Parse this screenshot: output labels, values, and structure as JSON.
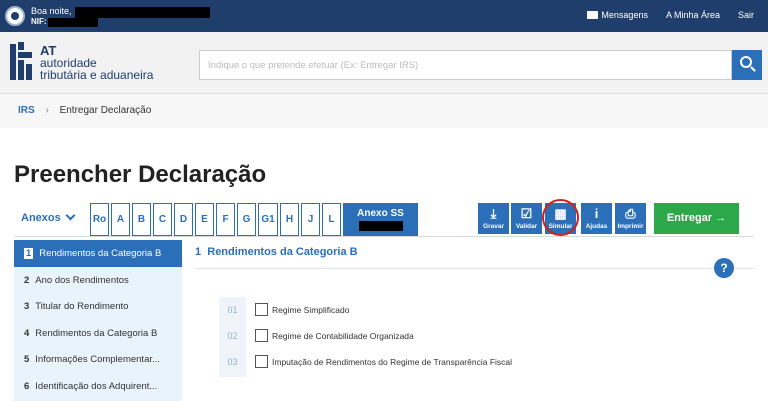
{
  "topbar": {
    "greeting": "Boa noite,",
    "nif_label": "NIF:",
    "links": [
      "Mensagens",
      "A Minha Área",
      "Sair"
    ]
  },
  "logo": {
    "line1": "AT",
    "line2": "autoridade",
    "line3": "tributária e aduaneira"
  },
  "search": {
    "placeholder": "Indique o que pretende efetuar (Ex: Entregar IRS)"
  },
  "breadcrumb": {
    "first": "IRS",
    "current": "Entregar Declaração"
  },
  "page_title": "Preencher Declaração",
  "toolbar": {
    "anexos_label": "Anexos",
    "tabs": [
      "Ro",
      "A",
      "B",
      "C",
      "D",
      "E",
      "F",
      "G",
      "G1",
      "H",
      "J",
      "L"
    ],
    "anexo_ss": "Anexo SS",
    "actions": [
      {
        "label": "Gravar",
        "icon": "download-icon"
      },
      {
        "label": "Validar",
        "icon": "check-icon"
      },
      {
        "label": "Simular",
        "icon": "calculator-icon"
      },
      {
        "label": "Ajudas",
        "icon": "info-icon"
      },
      {
        "label": "Imprimir",
        "icon": "printer-icon"
      }
    ],
    "entregar": "Entregar →"
  },
  "sidebar": {
    "items": [
      {
        "num": "1",
        "label": "Rendimentos da Categoria B"
      },
      {
        "num": "2",
        "label": "Ano dos Rendimentos"
      },
      {
        "num": "3",
        "label": "Titular do Rendimento"
      },
      {
        "num": "4",
        "label": "Rendimentos da Categoria B"
      },
      {
        "num": "5",
        "label": "Informações Complementar..."
      },
      {
        "num": "6",
        "label": "Identificação dos Adquirent..."
      }
    ]
  },
  "section": {
    "title_num": "1",
    "title": "Rendimentos da Categoria B",
    "help": "?",
    "options": [
      {
        "num": "01",
        "label": "Regime Simplificado"
      },
      {
        "num": "02",
        "label": "Regime de Contabilidade Organizada"
      },
      {
        "num": "03",
        "label": "Imputação de Rendimentos do Regime de Transparência Fiscal"
      }
    ]
  }
}
